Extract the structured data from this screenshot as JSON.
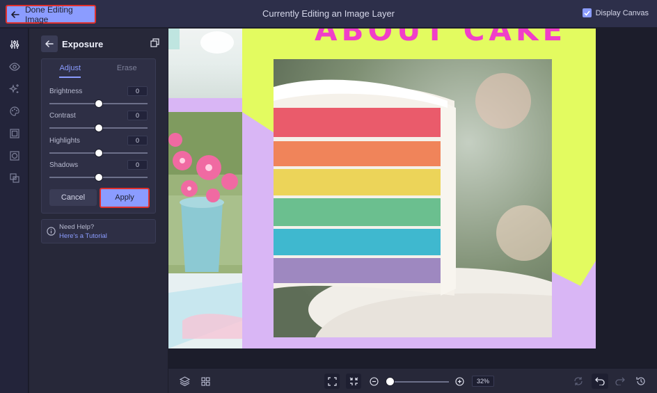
{
  "topbar": {
    "done_label": "Done Editing Image",
    "title": "Currently Editing an Image Layer",
    "display_canvas_label": "Display Canvas",
    "display_canvas_checked": true
  },
  "rail": {
    "icons": [
      "adjust-sliders-icon",
      "eye-icon",
      "sparkle-effects-icon",
      "paint-palette-icon",
      "crop-frame-icon",
      "mask-frame-icon",
      "layers-duplicate-icon"
    ]
  },
  "panel": {
    "title": "Exposure",
    "tabs": [
      {
        "label": "Adjust",
        "active": true
      },
      {
        "label": "Erase",
        "active": false
      }
    ],
    "sliders": [
      {
        "label": "Brightness",
        "value": "0",
        "level": 0.5
      },
      {
        "label": "Contrast",
        "value": "0",
        "level": 0.5
      },
      {
        "label": "Highlights",
        "value": "0",
        "level": 0.5
      },
      {
        "label": "Shadows",
        "value": "0",
        "level": 0.5
      }
    ],
    "cancel_label": "Cancel",
    "apply_label": "Apply",
    "help": {
      "title": "Need Help?",
      "link": "Here's a Tutorial"
    }
  },
  "canvas": {
    "headline": "ABOUT CAKE",
    "colors": {
      "background": "#d9b6f5",
      "accent_shape": "#e3fb60",
      "headline": "#f03fc8"
    }
  },
  "bottombar": {
    "zoom_value": "32%",
    "zoom_level": 0.0
  },
  "colors": {
    "accent": "#8b9cff",
    "highlight_outline": "#e0302c",
    "topbar_bg": "#2d2f4a",
    "panel_bg": "#272839"
  }
}
